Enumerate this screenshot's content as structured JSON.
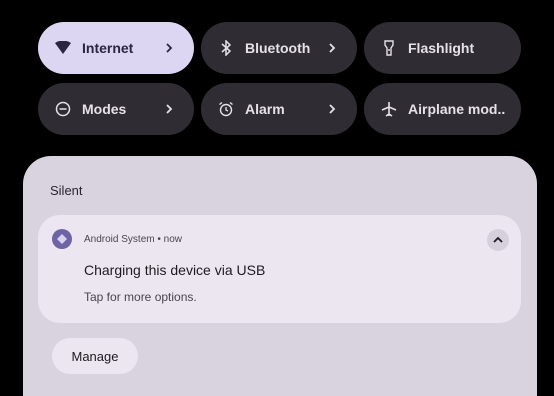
{
  "quick_settings": {
    "tiles": [
      {
        "label": "Internet",
        "icon": "wifi-icon",
        "active": true,
        "has_chevron": true
      },
      {
        "label": "Bluetooth",
        "icon": "bluetooth-icon",
        "active": false,
        "has_chevron": true
      },
      {
        "label": "Flashlight",
        "icon": "flashlight-icon",
        "active": false,
        "has_chevron": false
      },
      {
        "label": "Modes",
        "icon": "modes-icon",
        "active": false,
        "has_chevron": true
      },
      {
        "label": "Alarm",
        "icon": "alarm-icon",
        "active": false,
        "has_chevron": true
      },
      {
        "label": "Airplane mod..",
        "icon": "airplane-icon",
        "active": false,
        "has_chevron": false
      }
    ]
  },
  "notifications": {
    "section_label": "Silent",
    "items": [
      {
        "app_name": "Android System",
        "time": "now",
        "meta": "Android System • now",
        "title": "Charging this device via USB",
        "text": "Tap for more options.",
        "icon": "android-system-icon",
        "expand_icon": "chevron-up-icon"
      }
    ],
    "manage_label": "Manage"
  },
  "colors": {
    "background": "#000000",
    "tile_inactive": "#2f2d33",
    "tile_active": "#dcd6f2",
    "shade": "#d8d3de",
    "card": "#ebe6ef",
    "accent": "#6d64a6"
  }
}
